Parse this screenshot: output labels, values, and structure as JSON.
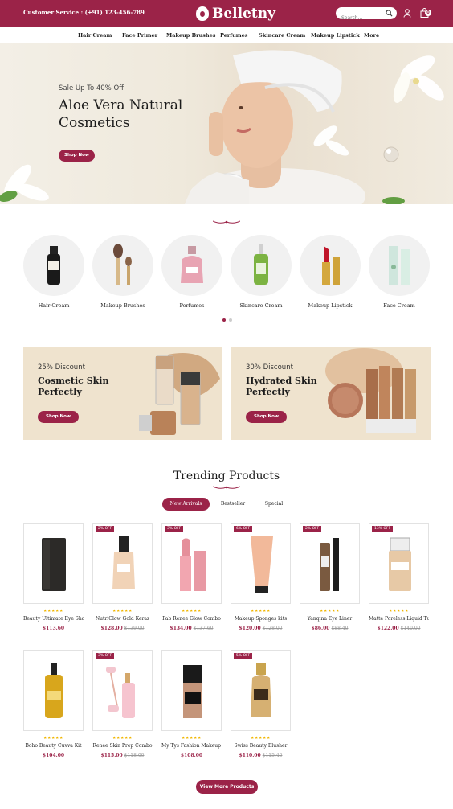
{
  "header": {
    "customer_service": "Customer Service : (+91) 123-456-789",
    "logo": "Belletny",
    "search_placeholder": "Search...",
    "cart_count": "0"
  },
  "nav": [
    "Hair Cream",
    "Face Primer",
    "Makeup Brushes",
    "Perfumes",
    "Skincare Cream",
    "Makeup Lipstick",
    "More"
  ],
  "hero": {
    "subtitle": "Sale Up To 40% Off",
    "title": "Aloe Vera Natural Cosmetics",
    "button": "Shop Now"
  },
  "categories": [
    "Hair Cream",
    "Makeup Brushes",
    "Perfumes",
    "Skincare Cream",
    "Makeup Lipstick",
    "Face Cream"
  ],
  "promos": [
    {
      "discount": "25% Discount",
      "title": "Cosmetic Skin Perfectly",
      "button": "Shop Now"
    },
    {
      "discount": "30% Discount",
      "title": "Hydrated Skin Perfectly",
      "button": "Shop Now"
    }
  ],
  "trending": {
    "title": "Trending Products",
    "tabs": [
      "New Arrivals",
      "Bestseller",
      "Special"
    ],
    "stars": "★★★★★",
    "products": [
      {
        "name": "Beauty Ultimate Eye Shad...",
        "price": "$113.60",
        "old": "",
        "off": ""
      },
      {
        "name": "NutriGlow Gold Keraz",
        "price": "$128.00",
        "old": "$139.00",
        "off": "2% OFF"
      },
      {
        "name": "Fab Renee Glow Combo",
        "price": "$134.00",
        "old": "$137.60",
        "off": "3% OFF"
      },
      {
        "name": "Makeup Sponges kits",
        "price": "$120.00",
        "old": "$128.00",
        "off": "6% OFF"
      },
      {
        "name": "Yanqina Eye Liner",
        "price": "$86.00",
        "old": "$88.40",
        "off": "2% OFF"
      },
      {
        "name": "Matte Poreless Liquid Tube",
        "price": "$122.00",
        "old": "$140.00",
        "off": "13% OFF"
      },
      {
        "name": "Boho Beauty Cuvva Kit",
        "price": "$104.00",
        "old": "",
        "off": ""
      },
      {
        "name": "Renee Skin Prep Combo",
        "price": "$115.00",
        "old": "$118.00",
        "off": "3% OFF"
      },
      {
        "name": "My Tys Fashion Makeup Kit",
        "price": "$108.00",
        "old": "",
        "off": ""
      },
      {
        "name": "Swiss Beauty Blusher",
        "price": "$110.00",
        "old": "$115.40",
        "off": "5% OFF"
      }
    ],
    "more_button": "View More Products"
  },
  "colors": {
    "brand": "#9b2348",
    "promo_bg": "#efe3ce",
    "star": "#f1b600"
  }
}
